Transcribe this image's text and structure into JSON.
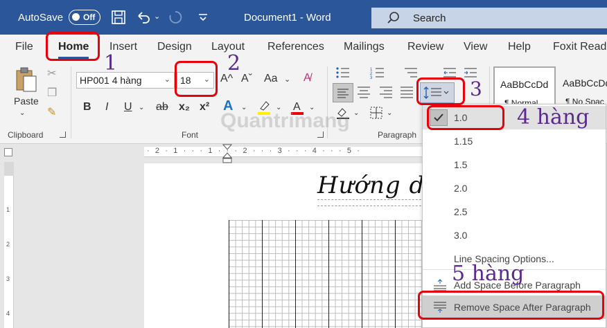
{
  "titlebar": {
    "autosave_label": "AutoSave",
    "autosave_state": "Off",
    "doc_title": "Document1  -  Word",
    "search_placeholder": "Search"
  },
  "tabs": [
    "File",
    "Home",
    "Insert",
    "Design",
    "Layout",
    "References",
    "Mailings",
    "Review",
    "View",
    "Help",
    "Foxit Read"
  ],
  "ribbon": {
    "clipboard": {
      "paste_label": "Paste",
      "group_label": "Clipboard"
    },
    "font": {
      "font_name": "HP001 4 hàng",
      "font_size": "18",
      "group_label": "Font",
      "bold": "B",
      "italic": "I",
      "underline": "U",
      "strike": "ab",
      "subscript": "x₂",
      "superscript": "x²",
      "grow": "A^",
      "shrink": "Aˇ",
      "case": "Aa"
    },
    "paragraph": {
      "group_label": "Paragraph"
    },
    "styles": [
      {
        "preview": "AaBbCcDd",
        "name": "¶ Normal"
      },
      {
        "preview": "AaBbCcDd",
        "name": "¶ No Spac"
      }
    ]
  },
  "ruler": {
    "ticks": "· 2 · 1 · · · 1 · · · 2 · · · 3 · · · 4 · · · 5 ·"
  },
  "document": {
    "heading": "Hướng dẫn"
  },
  "menu": {
    "items": [
      "1.0",
      "1.15",
      "1.5",
      "2.0",
      "2.5",
      "3.0"
    ],
    "selected": "1.0",
    "options_label": "Line Spacing Options...",
    "add_before": "Add Space Before Paragraph",
    "remove_after": "Remove Space After Paragraph"
  },
  "annotations": {
    "n1": "1",
    "n2": "2",
    "n3": "3",
    "n4": "4 hàng",
    "n5": "5 hàng"
  },
  "watermark": "Quantrimang",
  "colors": {
    "word_blue": "#2b579a",
    "annotation_red": "#e8000b",
    "annotation_purple": "#5a2a8c"
  }
}
